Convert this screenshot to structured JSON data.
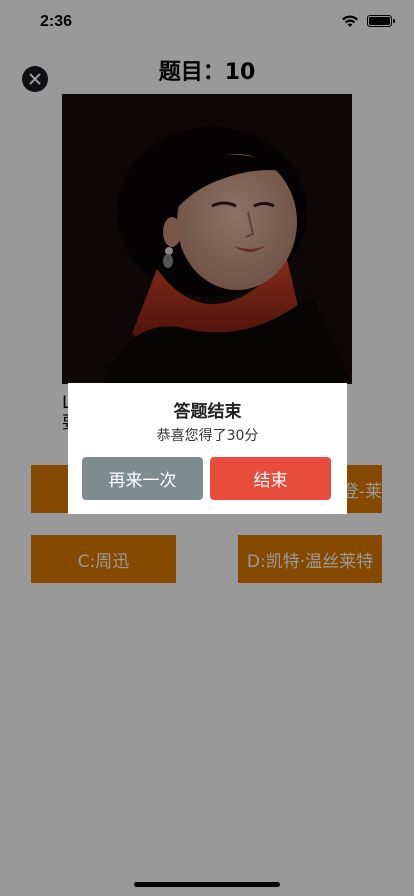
{
  "status_bar": {
    "time": "2:36"
  },
  "header": {
    "title": "题目：10"
  },
  "question": {
    "text": "L\n要"
  },
  "options": [
    {
      "label": "",
      "visible_text": ""
    },
    {
      "label": "登-莱"
    },
    {
      "label": "C:周迅"
    },
    {
      "label": "D:凯特·温丝莱特"
    }
  ],
  "dialog": {
    "title": "答题结束",
    "message": "恭喜您得了30分",
    "retry_label": "再来一次",
    "end_label": "结束"
  },
  "colors": {
    "option_bg": "#e07b00",
    "retry_bg": "#7d8c8e",
    "end_bg": "#e84c3d"
  }
}
